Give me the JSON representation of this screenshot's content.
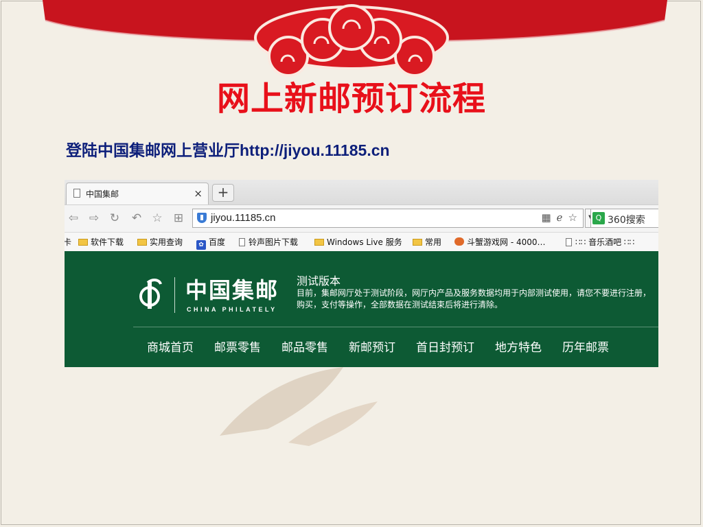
{
  "slide": {
    "title": "网上新邮预订流程",
    "subtitle": "登陆中国集邮网上营业厅http://jiyou.11185.cn"
  },
  "browser": {
    "tab": {
      "title": "中国集邮",
      "close": "×"
    },
    "new_tab": "+",
    "nav_icons": [
      "back-icon",
      "forward-icon",
      "reload-icon",
      "undo-icon",
      "favorite-icon",
      "grid-icon"
    ],
    "address": "jiyou.11185.cn",
    "search_label": "360搜索",
    "bookmarks": [
      {
        "label": "卡",
        "icon": "none"
      },
      {
        "label": "软件下载",
        "icon": "folder-icon"
      },
      {
        "label": "实用查询",
        "icon": "folder-icon"
      },
      {
        "label": "百度",
        "icon": "baidu-paw-icon"
      },
      {
        "label": "铃声图片下载",
        "icon": "page-icon"
      },
      {
        "label": "Windows Live 服务",
        "icon": "folder-icon"
      },
      {
        "label": "常用",
        "icon": "folder-icon"
      },
      {
        "label": "斗蟹游戏网 - 4000…",
        "icon": "crab-icon"
      },
      {
        "label": "∷∷ 音乐酒吧 ∷∷",
        "icon": "page-icon"
      }
    ]
  },
  "site": {
    "logo_cn": "中国集邮",
    "logo_en": "CHINA PHILATELY",
    "notice_title": "测试版本",
    "notice_body": "目前，集邮网厅处于测试阶段，网厅内产品及服务数据均用于内部测试使用，请您不要进行注册，购买，支付等操作，全部数据在测试结束后将进行清除。",
    "nav": [
      "商城首页",
      "邮票零售",
      "邮品零售",
      "新邮预订",
      "首日封预订",
      "地方特色",
      "历年邮票"
    ]
  },
  "colors": {
    "title_red": "#e8101a",
    "subtitle_blue": "#0d1f7a",
    "site_green": "#0d5a34",
    "banner_red": "#c8141e"
  }
}
